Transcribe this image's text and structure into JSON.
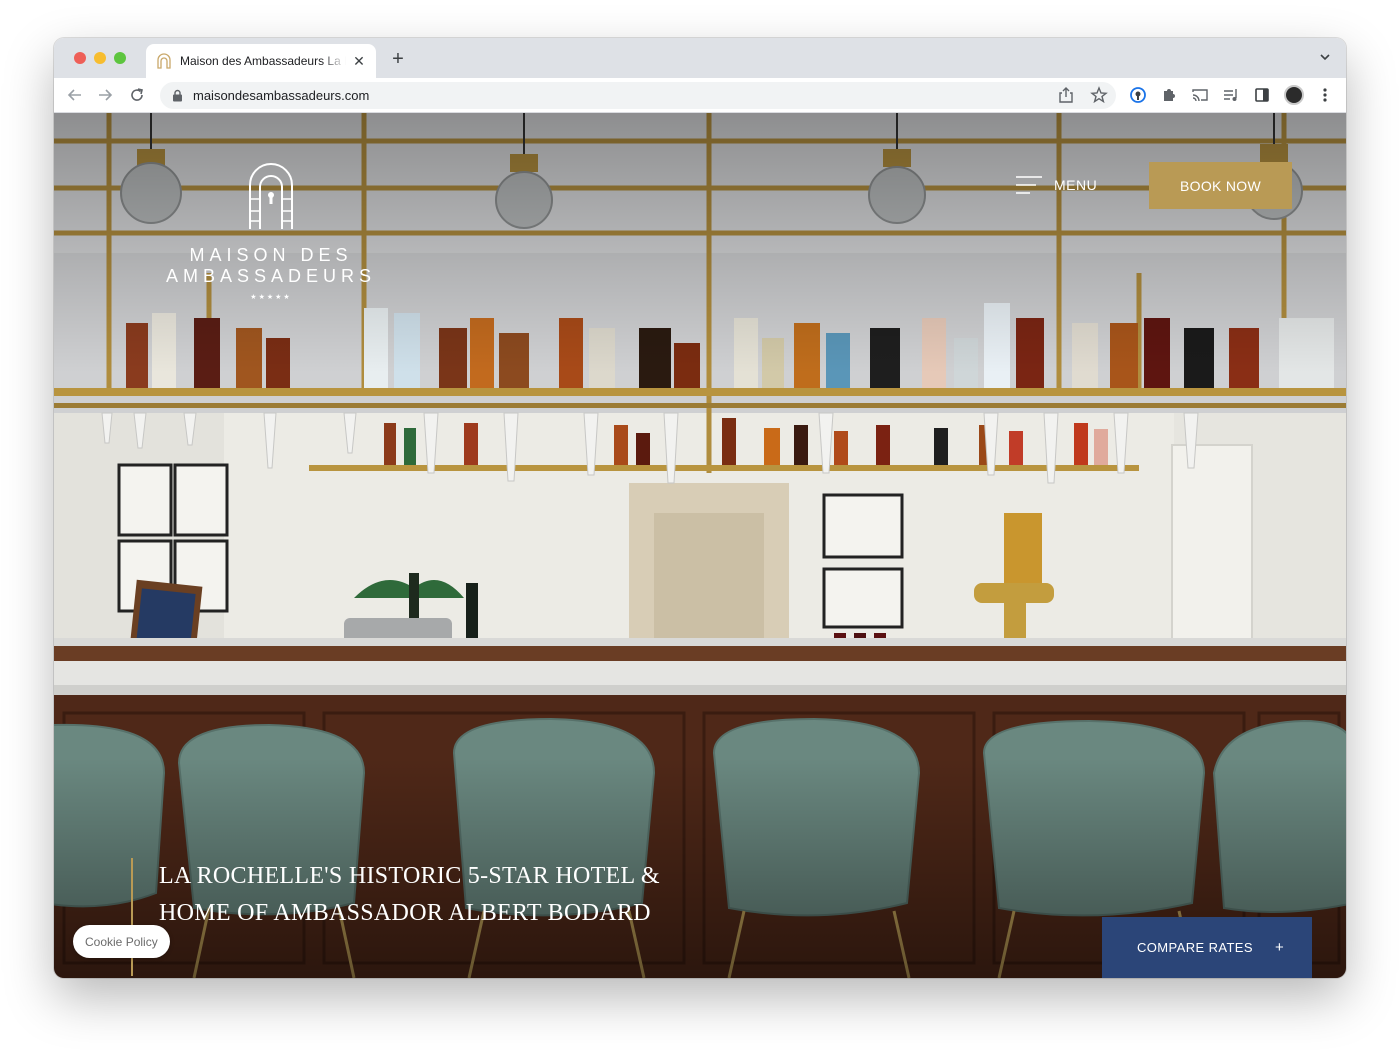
{
  "browser": {
    "tab_title": "Maison des Ambassadeurs La Rochelle",
    "tab_close": "✕",
    "new_tab": "+",
    "url": "maisondesambassadeurs.com",
    "icons": {
      "back": "back-arrow-icon",
      "forward": "forward-arrow-icon",
      "reload": "reload-icon",
      "share": "share-icon",
      "bookmark": "star-icon",
      "extensions": "puzzle-icon",
      "cast": "cast-icon",
      "media": "media-control-icon",
      "sidepanel": "side-panel-icon",
      "menu": "kebab-menu-icon"
    }
  },
  "site": {
    "logo_text": "MAISON DES AMBASSADEURS",
    "logo_stars": "★★★★★",
    "menu_label": "MENU",
    "book_now": "BOOK NOW",
    "tagline": [
      "LA ROCHELLE'S HISTORIC 5-STAR HOTEL &",
      "HOME OF AMBASSADOR ALBERT BODARD"
    ],
    "cookie_policy": "Cookie Policy",
    "compare_rates": "COMPARE RATES",
    "compare_plus": "+"
  },
  "colors": {
    "gold": "#b99a55",
    "navy": "#2b4578",
    "wood": "#5a2e1c",
    "chair": "#6d8a82"
  }
}
